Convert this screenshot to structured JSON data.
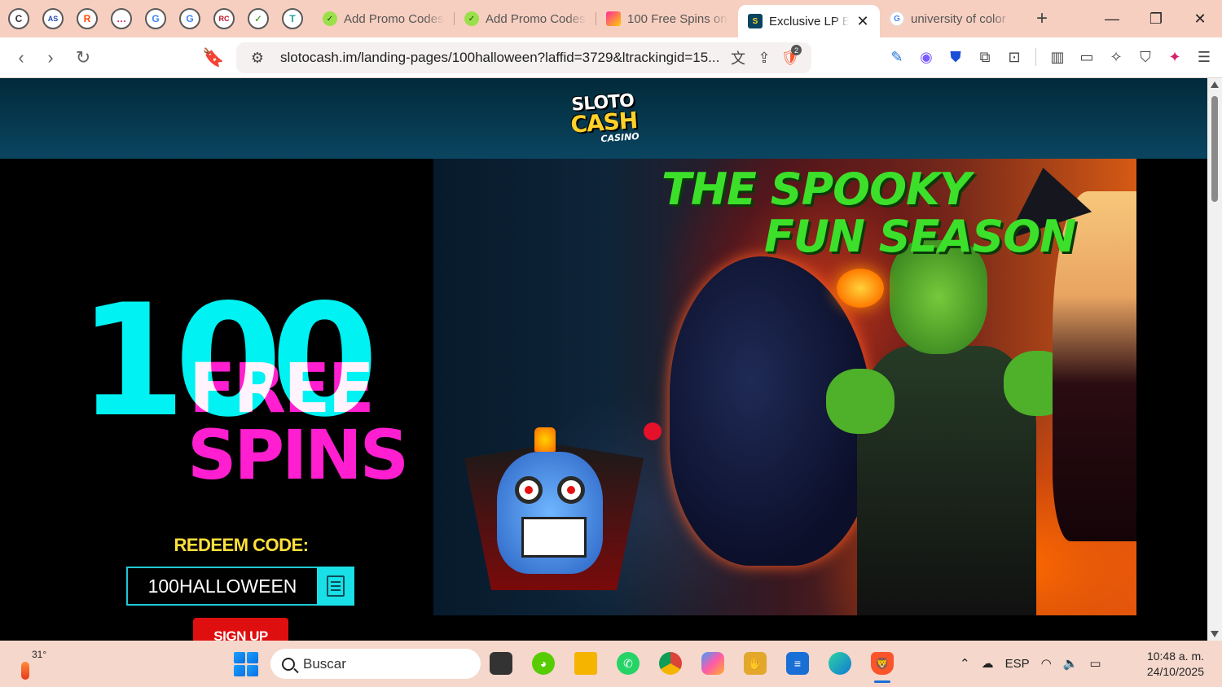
{
  "browser": {
    "pinned_tabs": [
      {
        "icon": "cashback-icon",
        "letter": "C"
      },
      {
        "icon": "asb-icon",
        "letter": "AS"
      },
      {
        "icon": "reddit-icon",
        "letter": "R"
      },
      {
        "icon": "chat-icon",
        "letter": "…"
      },
      {
        "icon": "google-lens-icon",
        "letter": "G"
      },
      {
        "icon": "google-icon",
        "letter": "G"
      },
      {
        "icon": "rc-icon",
        "letter": "RC"
      },
      {
        "icon": "promo-icon",
        "letter": "✓"
      },
      {
        "icon": "t-icon",
        "letter": "T"
      }
    ],
    "tabs": [
      {
        "title": "Add Promo Codes",
        "icon": "promo-check-icon",
        "active": false
      },
      {
        "title": "Add Promo Codes",
        "icon": "promo-check-icon",
        "active": false
      },
      {
        "title": "100 Free Spins on",
        "icon": "spins-icon",
        "active": false
      },
      {
        "title": "Exclusive LP B",
        "icon": "slotocash-icon",
        "active": true
      },
      {
        "title": "university of color",
        "icon": "google-icon",
        "active": false
      }
    ],
    "url": "slotocash.im/landing-pages/100halloween?laffid=3729&ltrackingid=15...",
    "shield_badge": "2",
    "colors": {
      "tabstrip": "#f7cfc0",
      "accent": "#1a6fd6"
    }
  },
  "page": {
    "logo": {
      "line1": "SLOTO",
      "line2": "CASH",
      "line3": "CASINO"
    },
    "promo": {
      "number": "100",
      "free": "FREE",
      "spins": "SPINS",
      "redeem_label": "REDEEM CODE:",
      "code": "100HALLOWEEN",
      "signup": "SIGN UP"
    },
    "banner": {
      "line1": "THE SPOOKY",
      "line2": "FUN SEASON"
    },
    "colors": {
      "cyan": "#00f2f2",
      "magenta": "#ff1fd0",
      "yellow": "#ffe03a",
      "red_button": "#e00f0f",
      "green_title": "#3ce02a"
    }
  },
  "taskbar": {
    "weather_temp": "31°",
    "search_placeholder": "Buscar",
    "apps": [
      {
        "name": "file-explorer-dark-icon",
        "color": "#333"
      },
      {
        "name": "duolingo-icon",
        "color": "#58cc02"
      },
      {
        "name": "folder-icon",
        "color": "#f4b400"
      },
      {
        "name": "whatsapp-icon",
        "color": "#25d366"
      },
      {
        "name": "chrome-icon",
        "color": "#db4437"
      },
      {
        "name": "copilot-icon",
        "color": "#7a5cff"
      },
      {
        "name": "hand-cursor-icon",
        "color": "#e3a82b"
      },
      {
        "name": "notepad-icon",
        "color": "#1a6fd6"
      },
      {
        "name": "edge-icon",
        "color": "#0f7bd6"
      },
      {
        "name": "brave-icon",
        "color": "#fb542b"
      }
    ],
    "language": "ESP",
    "time": "10:48 a. m.",
    "date": "24/10/2025"
  }
}
